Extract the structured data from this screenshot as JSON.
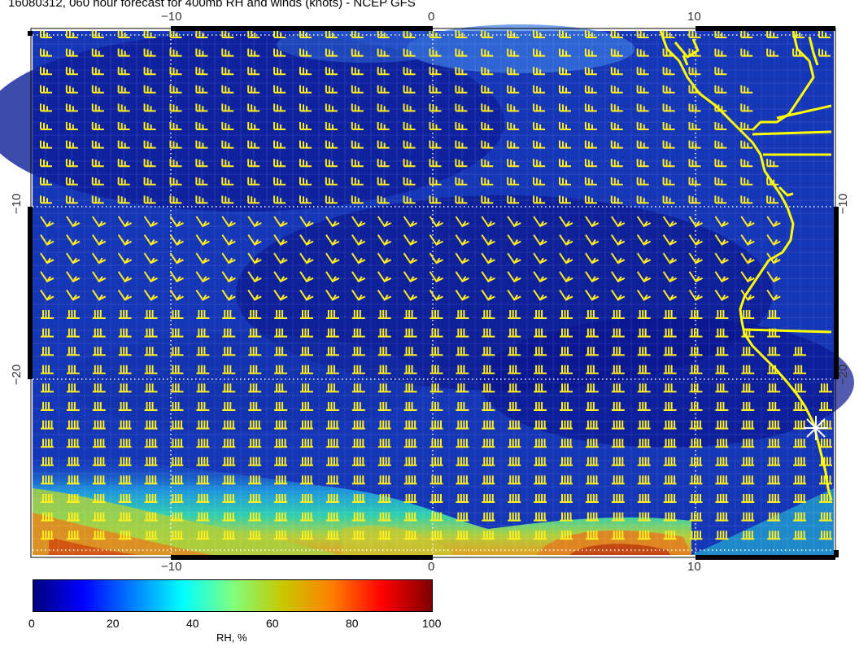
{
  "title": "16080312, 060 hour forecast for 400mb RH and winds (knots) - NCEP GFS",
  "axes": {
    "x_ticks_top": [
      "−10",
      "0",
      "10"
    ],
    "x_ticks_bottom": [
      "−10",
      "0",
      "10"
    ],
    "y_ticks_left": [
      "−10",
      "−20"
    ],
    "y_ticks_right": [
      "−10",
      "−20"
    ]
  },
  "colorbar": {
    "title": "RH, %",
    "ticks": [
      "0",
      "20",
      "40",
      "60",
      "80",
      "100"
    ],
    "stops": [
      "#00007f",
      "#0000ff",
      "#007fff",
      "#00ffff",
      "#7fff7f",
      "#c8c800",
      "#ff7f00",
      "#ff0000",
      "#7f0000"
    ]
  },
  "colors": {
    "ocean_background": "#1030b0",
    "wind_barb": "#ffee22",
    "coastline": "#ffff00",
    "gridline": "#ffffff"
  },
  "map": {
    "field": "400mb relative humidity (%)",
    "overlay": "wind barbs (knots)",
    "marker": "white star at station near coast"
  }
}
